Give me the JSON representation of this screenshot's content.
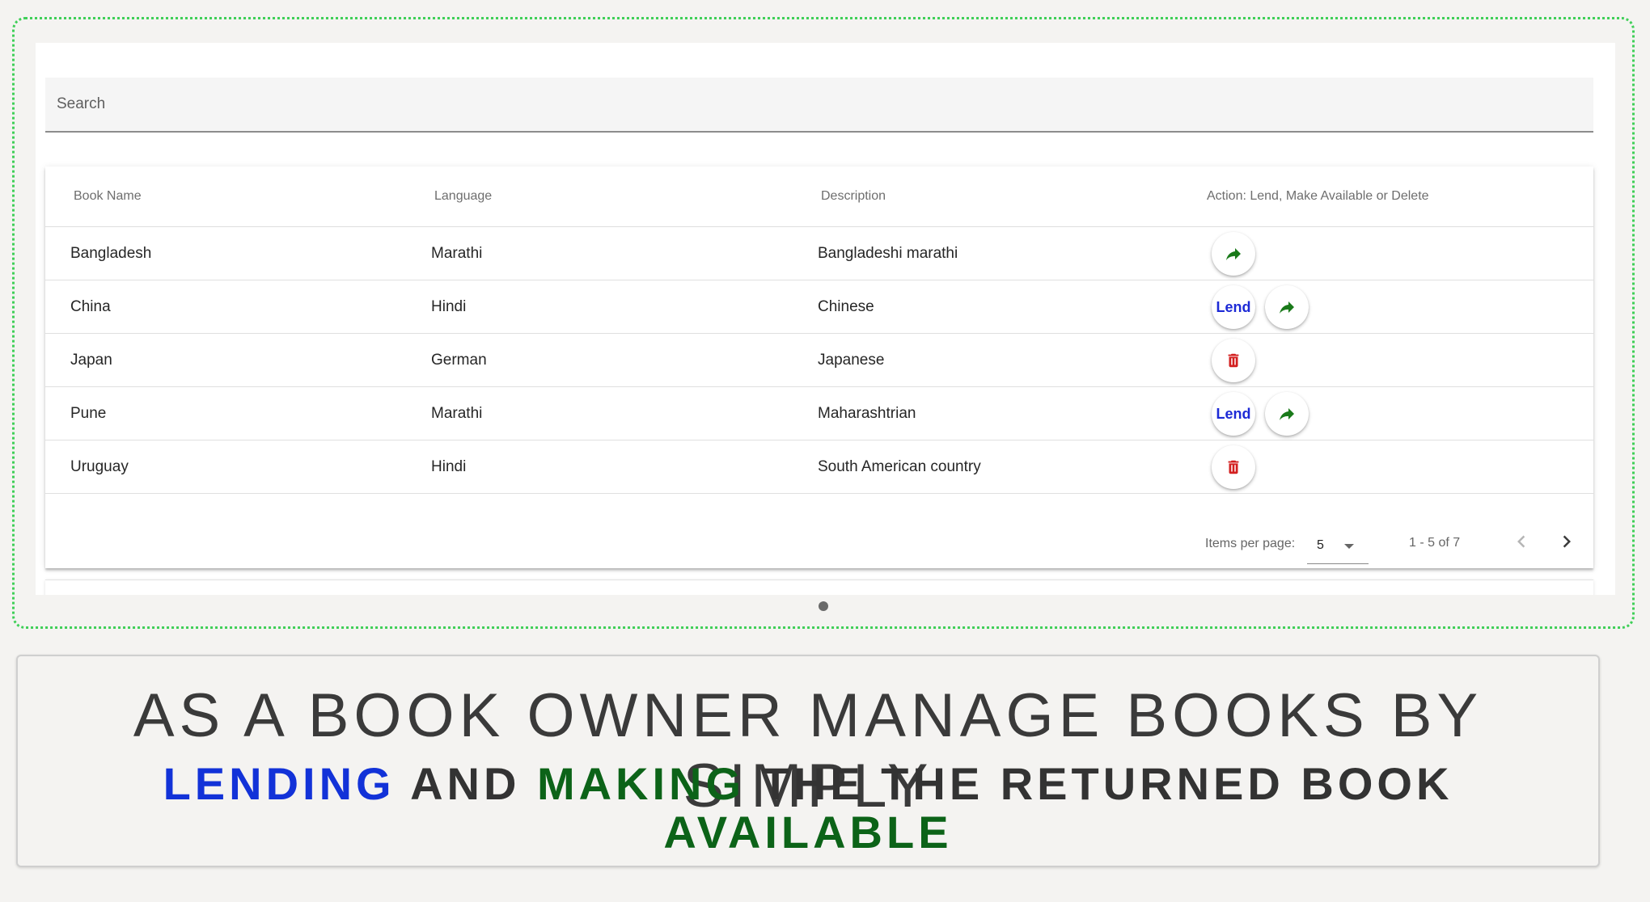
{
  "search": {
    "placeholder": "Search"
  },
  "table": {
    "headers": [
      "Book Name",
      "Language",
      "Description",
      "Action: Lend, Make Available or Delete"
    ],
    "rows": [
      {
        "name": "Bangladesh",
        "language": "Marathi",
        "description": "Bangladeshi marathi",
        "actions": [
          "share-arrow"
        ]
      },
      {
        "name": "China",
        "language": "Hindi",
        "description": "Chinese",
        "actions": [
          "lend",
          "share-arrow"
        ]
      },
      {
        "name": "Japan",
        "language": "German",
        "description": "Japanese",
        "actions": [
          "delete"
        ]
      },
      {
        "name": "Pune",
        "language": "Marathi",
        "description": "Maharashtrian",
        "actions": [
          "lend",
          "share-arrow"
        ]
      },
      {
        "name": "Uruguay",
        "language": "Hindi",
        "description": "South American country",
        "actions": [
          "delete"
        ]
      }
    ],
    "lend_label": "Lend"
  },
  "paginator": {
    "items_per_page_label": "Items per page:",
    "page_size": "5",
    "range": "1 - 5 of 7"
  },
  "caption": {
    "line1": "AS A BOOK OWNER MANAGE BOOKS BY SIMPLY",
    "lending": "LENDING",
    "and": "AND",
    "making": "MAKING",
    "rest": "THE THE RETURNED BOOK",
    "available": "AVAILABLE"
  },
  "colors": {
    "lend_blue": "#1d2ad6",
    "arrow_green": "#1a7a1a",
    "delete_red": "#d32020",
    "frame_green": "#3fcf58"
  }
}
